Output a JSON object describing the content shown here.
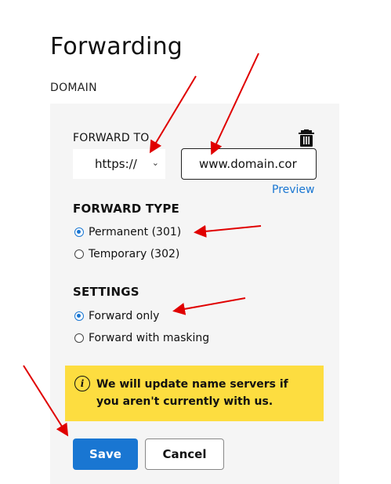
{
  "page": {
    "title": "Forwarding",
    "section": "DOMAIN"
  },
  "forward_to": {
    "label": "FORWARD TO",
    "protocol": "https://",
    "url_value": "www.domain.cor",
    "preview_label": "Preview",
    "delete_icon": "trash-icon"
  },
  "forward_type": {
    "heading": "FORWARD TYPE",
    "options": [
      {
        "label": "Permanent (301)",
        "checked": true
      },
      {
        "label": "Temporary (302)",
        "checked": false
      }
    ]
  },
  "settings": {
    "heading": "SETTINGS",
    "options": [
      {
        "label": "Forward only",
        "checked": true
      },
      {
        "label": "Forward with masking",
        "checked": false
      }
    ]
  },
  "notice": {
    "icon": "info-icon",
    "text": "We will update name servers if you aren't currently with us."
  },
  "actions": {
    "save_label": "Save",
    "cancel_label": "Cancel"
  },
  "colors": {
    "accent": "#1976d2",
    "notice": "#fddd40",
    "annotation": "#e00000"
  }
}
